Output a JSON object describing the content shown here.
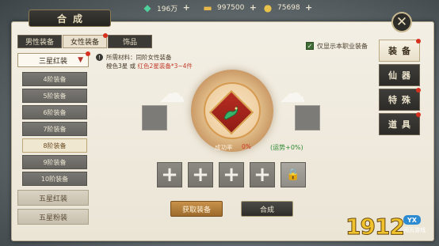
{
  "currency": {
    "jade": "196万",
    "ingot": "997500",
    "coin": "75698",
    "plus": "+"
  },
  "window": {
    "title": "合成",
    "close": "✕"
  },
  "tabs": [
    {
      "label": "男性装备",
      "active": false
    },
    {
      "label": "女性装备",
      "active": true
    },
    {
      "label": "饰品",
      "active": false
    }
  ],
  "dropdown": {
    "value": "三星红装",
    "arrow": "▼"
  },
  "tiers": [
    "4阶装备",
    "5阶装备",
    "6阶装备",
    "7阶装备",
    "8阶装备",
    "9阶装备",
    "10阶装备"
  ],
  "selected_tier": "8阶装备",
  "categories": [
    "五星红装",
    "五星粉装"
  ],
  "info": {
    "icon": "!",
    "line1": "所需材料：同阶女性装备",
    "line2_prefix": "橙色3星 或 ",
    "line2_red": "红色2星装备*3~4件"
  },
  "filter": {
    "checked": true,
    "label": "仅显示本职业装备",
    "mark": "✓"
  },
  "side_nav": [
    {
      "label": "装备",
      "active": true
    },
    {
      "label": "仙器",
      "active": false
    },
    {
      "label": "特殊",
      "active": false
    },
    {
      "label": "道具",
      "active": false
    }
  ],
  "synth": {
    "rate_label": "成功率",
    "rate_value": "0%",
    "luck": "(运势+0%)",
    "slot_plus": "+",
    "lock_icon": "🔒"
  },
  "buttons": {
    "get": "获取装备",
    "synthesize": "合成"
  },
  "watermark": {
    "number": "1912",
    "badge": "YX",
    "sub": "网页游戏"
  },
  "colors": {
    "accent_red": "#d6311f",
    "panel": "#f0ebdf",
    "dark": "#2d2c29",
    "gold": "#d7a24e"
  }
}
